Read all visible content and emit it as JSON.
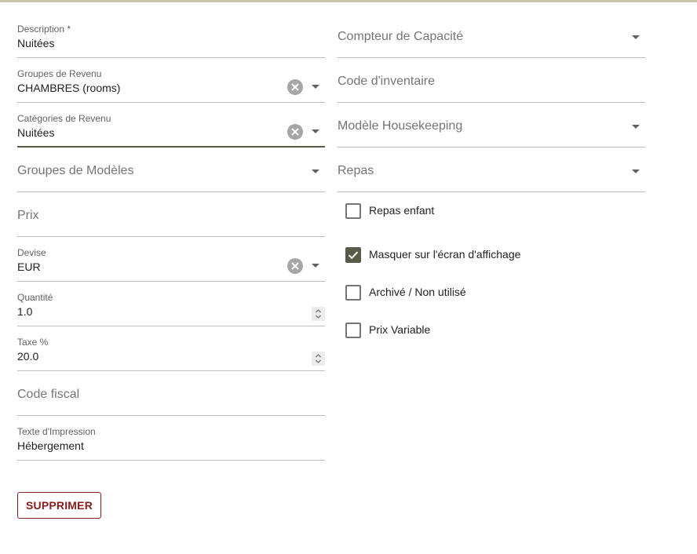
{
  "left_fields": {
    "description": {
      "label": "Description *",
      "value": "Nuitées"
    },
    "revenue_groups": {
      "label": "Groupes de Revenu",
      "value": "CHAMBRES (rooms)"
    },
    "revenue_categories": {
      "label": "Catégories de Revenu",
      "value": "Nuitées"
    },
    "model_groups": {
      "placeholder": "Groupes de Modèles"
    },
    "price": {
      "placeholder": "Prix"
    },
    "currency": {
      "label": "Devise",
      "value": "EUR"
    },
    "quantity": {
      "label": "Quantité",
      "value": "1.0"
    },
    "tax": {
      "label": "Taxe %",
      "value": "20.0"
    },
    "fiscal_code": {
      "placeholder": "Code fiscal"
    },
    "print_text": {
      "label": "Texte d'Impression",
      "value": "Hébergement"
    }
  },
  "right_fields": {
    "capacity_counter": {
      "placeholder": "Compteur de Capacité"
    },
    "inventory_code": {
      "placeholder": "Code d'inventaire"
    },
    "housekeeping_model": {
      "placeholder": "Modèle Housekeeping"
    },
    "meals": {
      "placeholder": "Repas"
    }
  },
  "checkboxes": [
    {
      "label": "Repas enfant",
      "checked": false
    },
    {
      "label": "Masquer sur l'écran d'affichage",
      "checked": true
    },
    {
      "label": "Archivé / Non utilisé",
      "checked": false
    },
    {
      "label": "Prix Variable",
      "checked": false
    }
  ],
  "actions": {
    "delete_label": "SUPPRIMER"
  },
  "colors": {
    "accent": "#5a5a48",
    "danger": "#8b1a1a",
    "top_strip": "#cdc5a8"
  }
}
